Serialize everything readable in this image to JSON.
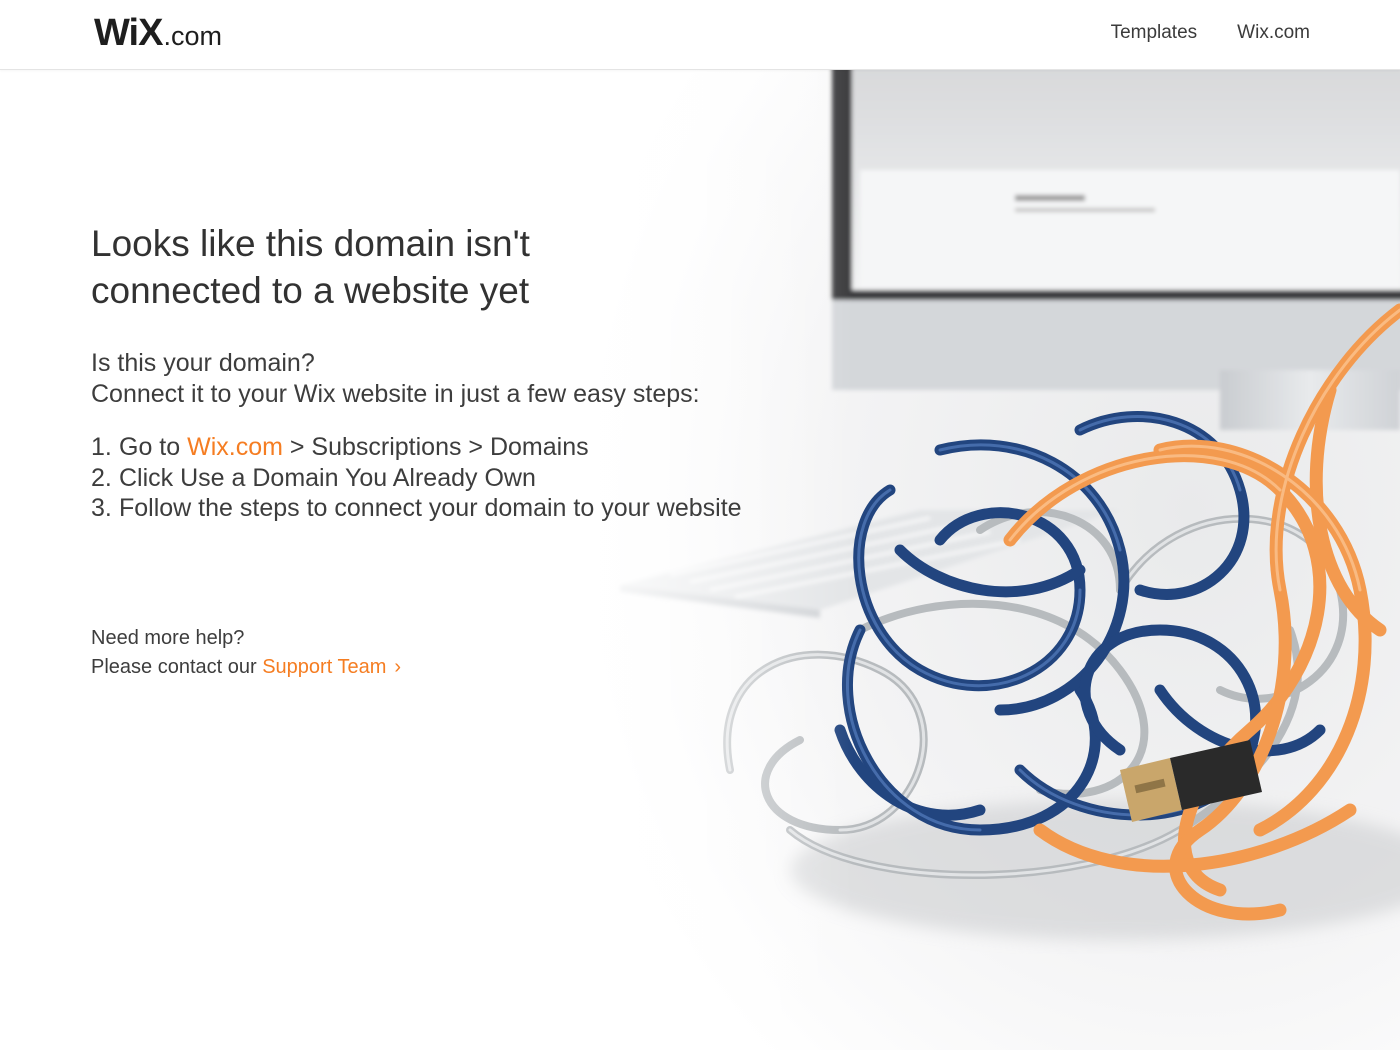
{
  "header": {
    "logo_wordmark": "WiX",
    "logo_suffix": ".com",
    "nav": [
      {
        "label": "Templates"
      },
      {
        "label": "Wix.com"
      }
    ]
  },
  "main": {
    "headline_line1": "Looks like this domain isn't",
    "headline_line2": "connected to a website yet",
    "question": "Is this your domain?",
    "connect_text": "Connect it to your Wix website in just a few easy steps:",
    "steps": [
      {
        "num": "1.",
        "prefix": "Go to ",
        "link": "Wix.com",
        "suffix": " > Subscriptions > Domains"
      },
      {
        "num": "2.",
        "text": "Click Use a Domain You Already Own"
      },
      {
        "num": "3.",
        "text": "Follow the steps to connect your domain to your website"
      }
    ]
  },
  "help": {
    "title": "Need more help?",
    "contact_prefix": "Please contact our ",
    "support_link": "Support Team",
    "chevron": "›"
  },
  "colors": {
    "accent": "#f57d22",
    "text": "#3d3d3d",
    "cable_blue": "#22457f",
    "cable_orange": "#f39a4f",
    "cable_silver": "#b8bcbf"
  }
}
